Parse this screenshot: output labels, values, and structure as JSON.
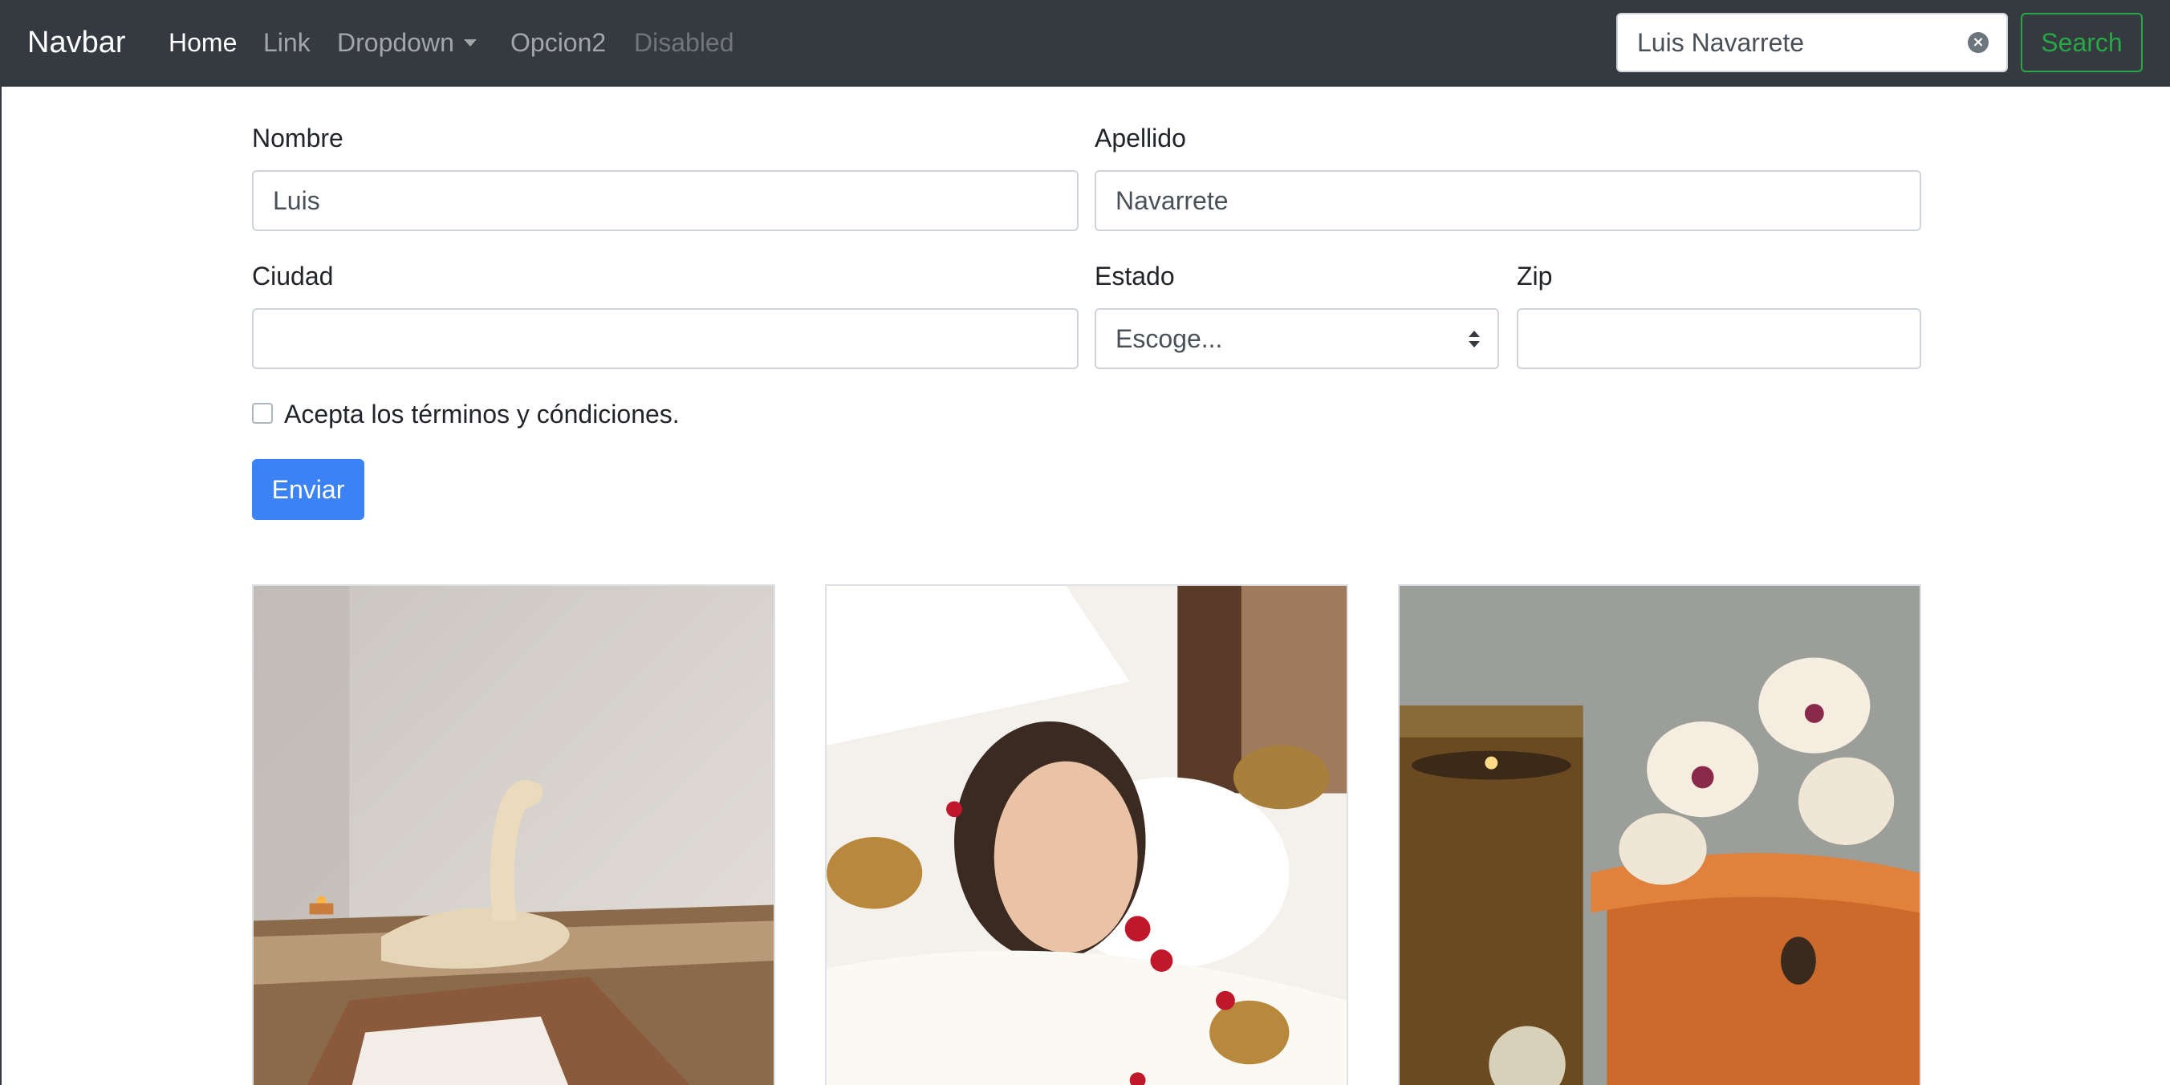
{
  "navbar": {
    "brand": "Navbar",
    "links": [
      {
        "label": "Home"
      },
      {
        "label": "Link"
      },
      {
        "label": "Dropdown"
      },
      {
        "label": "Opcion2"
      },
      {
        "label": "Disabled"
      }
    ],
    "search": {
      "value": "Luis Navarrete"
    },
    "search_button": "Search"
  },
  "form": {
    "nombre": {
      "label": "Nombre",
      "value": "Luis"
    },
    "apellido": {
      "label": "Apellido",
      "value": "Navarrete"
    },
    "ciudad": {
      "label": "Ciudad",
      "value": ""
    },
    "estado": {
      "label": "Estado",
      "selected": "Escoge..."
    },
    "zip": {
      "label": "Zip",
      "value": ""
    },
    "terms": {
      "label": "Acepta los términos y cóndiciones.",
      "checked": false
    },
    "submit": "Enviar"
  },
  "colors": {
    "navbar_bg": "#343a40",
    "primary": "#3b82f6",
    "success": "#28a745"
  },
  "gallery": [
    {
      "subject": "towel swan on massage table"
    },
    {
      "subject": "woman relaxing with singing bowls and rose petals"
    },
    {
      "subject": "candle, orchids and rolled orange towels"
    }
  ]
}
